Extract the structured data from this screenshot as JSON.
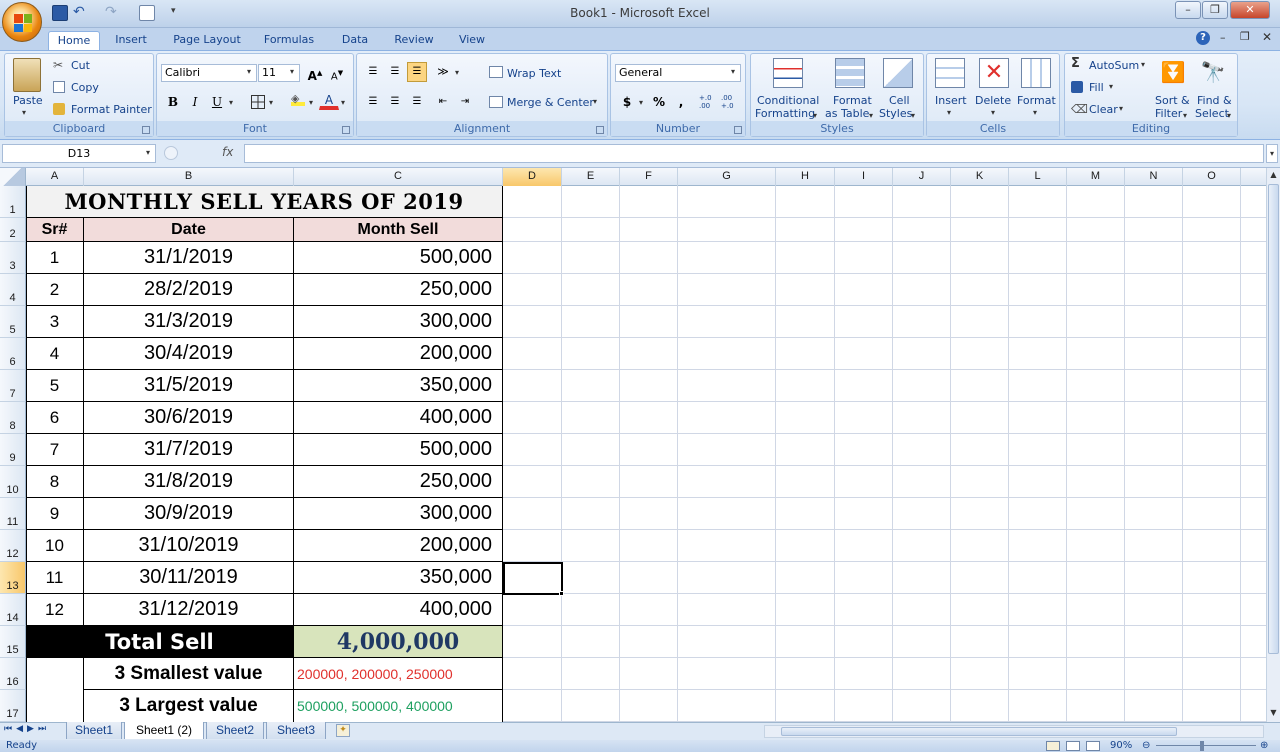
{
  "window": {
    "title": "Book1 - Microsoft Excel"
  },
  "ribbon_tabs": [
    "Home",
    "Insert",
    "Page Layout",
    "Formulas",
    "Data",
    "Review",
    "View"
  ],
  "clipboard": {
    "paste": "Paste",
    "cut": "Cut",
    "copy": "Copy",
    "format_painter": "Format Painter",
    "label": "Clipboard"
  },
  "font": {
    "name": "Calibri",
    "size": "11",
    "bold": "B",
    "italic": "I",
    "underline": "U",
    "color_letter": "A",
    "label": "Font"
  },
  "alignment": {
    "wrap": "Wrap Text",
    "merge": "Merge & Center",
    "label": "Alignment"
  },
  "number": {
    "format": "General",
    "currency": "$",
    "percent": "%",
    "comma": ",",
    "inc_dec": "+.0 .00",
    "dec_dec": ".00 +.0",
    "label": "Number"
  },
  "styles": {
    "conditional_1": "Conditional",
    "conditional_2": "Formatting",
    "format_table_1": "Format",
    "format_table_2": "as Table",
    "cell_styles_1": "Cell",
    "cell_styles_2": "Styles",
    "label": "Styles"
  },
  "cells_group": {
    "insert": "Insert",
    "delete": "Delete",
    "format": "Format",
    "label": "Cells"
  },
  "editing": {
    "autosum": "AutoSum",
    "fill": "Fill",
    "clear": "Clear",
    "sort_1": "Sort &",
    "sort_2": "Filter",
    "find_1": "Find &",
    "find_2": "Select",
    "label": "Editing"
  },
  "formula_bar": {
    "name_box": "D13",
    "fx": "fx",
    "formula": ""
  },
  "columns": [
    "A",
    "B",
    "C",
    "D",
    "E",
    "F",
    "G",
    "H",
    "I",
    "J",
    "K",
    "L",
    "M",
    "N",
    "O"
  ],
  "rows": [
    "1",
    "2",
    "3",
    "4",
    "5",
    "6",
    "7",
    "8",
    "9",
    "10",
    "11",
    "12",
    "13",
    "14",
    "15",
    "16",
    "17"
  ],
  "sheet": {
    "title": "MONTHLY SELL YEARS OF 2019",
    "headers": {
      "sr": "Sr#",
      "date": "Date",
      "sell": "Month Sell"
    },
    "data": [
      {
        "sr": "1",
        "date": "31/1/2019",
        "sell": "500,000"
      },
      {
        "sr": "2",
        "date": "28/2/2019",
        "sell": "250,000"
      },
      {
        "sr": "3",
        "date": "31/3/2019",
        "sell": "300,000"
      },
      {
        "sr": "4",
        "date": "30/4/2019",
        "sell": "200,000"
      },
      {
        "sr": "5",
        "date": "31/5/2019",
        "sell": "350,000"
      },
      {
        "sr": "6",
        "date": "30/6/2019",
        "sell": "400,000"
      },
      {
        "sr": "7",
        "date": "31/7/2019",
        "sell": "500,000"
      },
      {
        "sr": "8",
        "date": "31/8/2019",
        "sell": "250,000"
      },
      {
        "sr": "9",
        "date": "30/9/2019",
        "sell": "300,000"
      },
      {
        "sr": "10",
        "date": "31/10/2019",
        "sell": "200,000"
      },
      {
        "sr": "11",
        "date": "30/11/2019",
        "sell": "350,000"
      },
      {
        "sr": "12",
        "date": "31/12/2019",
        "sell": "400,000"
      }
    ],
    "total_label": "Total Sell",
    "total_value": "4,000,000",
    "smallest_label": "3 Smallest value",
    "smallest_value": "200000, 200000, 250000",
    "largest_label": "3 Largest value",
    "largest_value": "500000, 500000, 400000"
  },
  "sheet_tabs": [
    "Sheet1",
    "Sheet1 (2)",
    "Sheet2",
    "Sheet3"
  ],
  "active_sheet": "Sheet1 (2)",
  "status": {
    "ready": "Ready",
    "zoom": "90%"
  },
  "colors": {
    "accent": "#15428b",
    "header_fill": "#f2dcdb",
    "total_fill": "#d8e4bc",
    "smallest_color": "#e0302c",
    "largest_color": "#1ea060"
  }
}
